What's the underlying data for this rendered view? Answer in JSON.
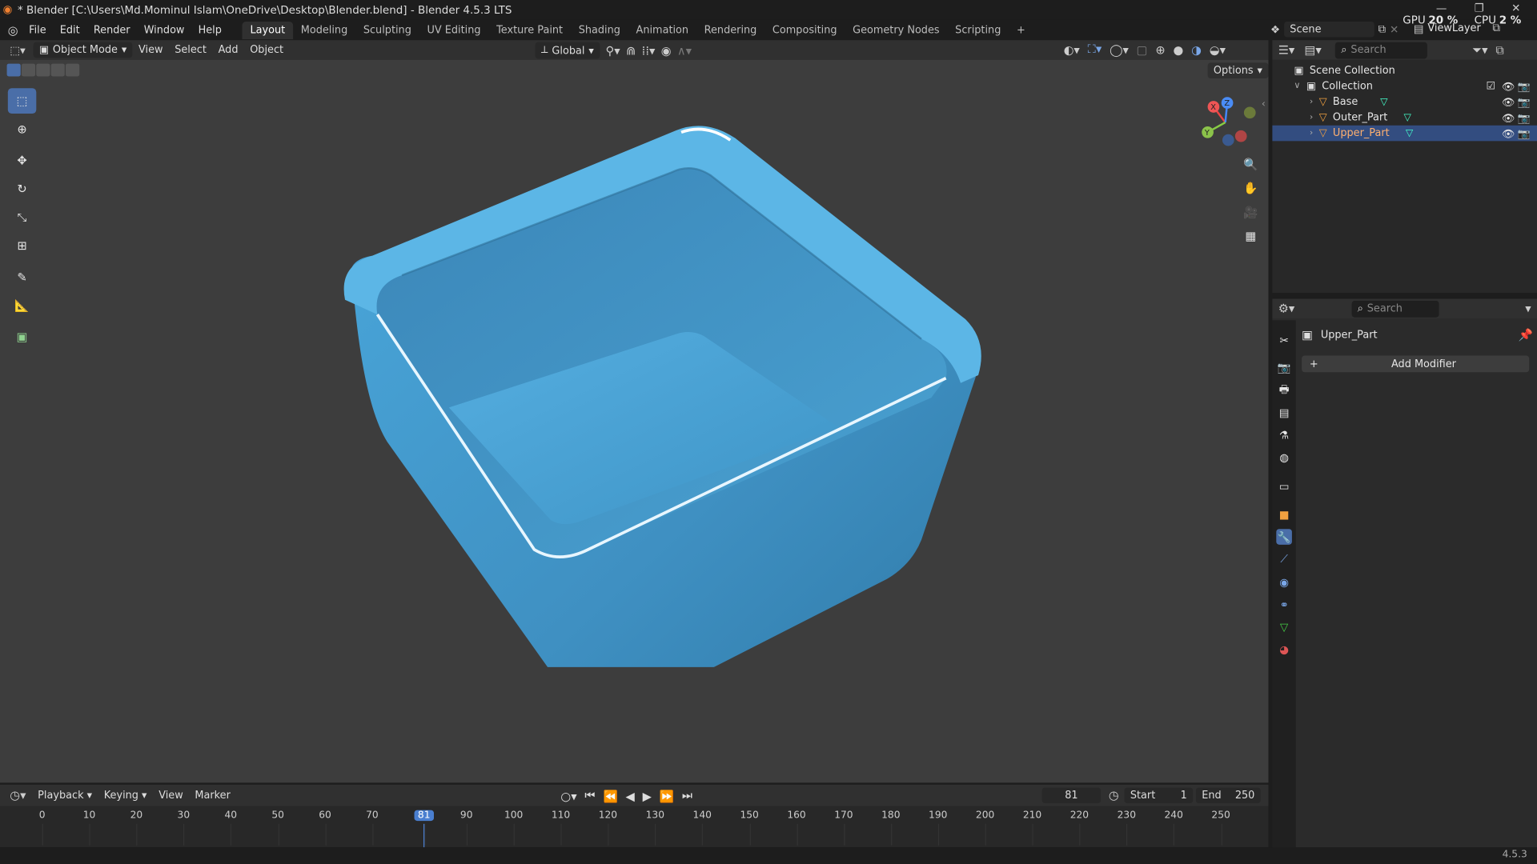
{
  "window": {
    "title": "* Blender [C:\\Users\\Md.Mominul Islam\\OneDrive\\Desktop\\Blender.blend] - Blender 4.5.3 LTS",
    "gpu_label": "GPU",
    "gpu_value": "20 %",
    "cpu_label": "CPU",
    "cpu_value": "2 %"
  },
  "menu": {
    "items": [
      "File",
      "Edit",
      "Render",
      "Window",
      "Help"
    ]
  },
  "workspaces": {
    "tabs": [
      "Layout",
      "Modeling",
      "Sculpting",
      "UV Editing",
      "Texture Paint",
      "Shading",
      "Animation",
      "Rendering",
      "Compositing",
      "Geometry Nodes",
      "Scripting"
    ],
    "active": "Layout",
    "add": "+"
  },
  "topright": {
    "scene": "Scene",
    "view_layer": "ViewLayer"
  },
  "viewport_header": {
    "mode": "Object Mode",
    "view": "View",
    "select": "Select",
    "add": "Add",
    "object": "Object",
    "orientation": "Global",
    "options": "Options"
  },
  "outliner": {
    "search_placeholder": "Search",
    "scene_collection": "Scene Collection",
    "collection": "Collection",
    "objects": [
      {
        "name": "Base"
      },
      {
        "name": "Outer_Part"
      },
      {
        "name": "Upper_Part"
      }
    ],
    "selected": "Upper_Part"
  },
  "properties": {
    "search_placeholder": "Search",
    "object_name": "Upper_Part",
    "add_modifier": "Add Modifier"
  },
  "timeline": {
    "playback": "Playback",
    "keying": "Keying",
    "view": "View",
    "marker": "Marker",
    "current_frame": "81",
    "start_label": "Start",
    "start_value": "1",
    "end_label": "End",
    "end_value": "250",
    "ticks": [
      "0",
      "10",
      "20",
      "30",
      "40",
      "50",
      "60",
      "70",
      "81",
      "90",
      "100",
      "110",
      "120",
      "130",
      "140",
      "150",
      "160",
      "170",
      "180",
      "190",
      "200",
      "210",
      "220",
      "230",
      "240",
      "250"
    ]
  },
  "gizmo": {
    "x": "X",
    "y": "Y",
    "z": "Z"
  },
  "status": {
    "version": "4.5.3"
  },
  "colors": {
    "accent": "#4a6ea8",
    "selected_row": "#334d80",
    "object_blue": "#4ba3d3",
    "viewport_bg": "#3d3d3d"
  }
}
